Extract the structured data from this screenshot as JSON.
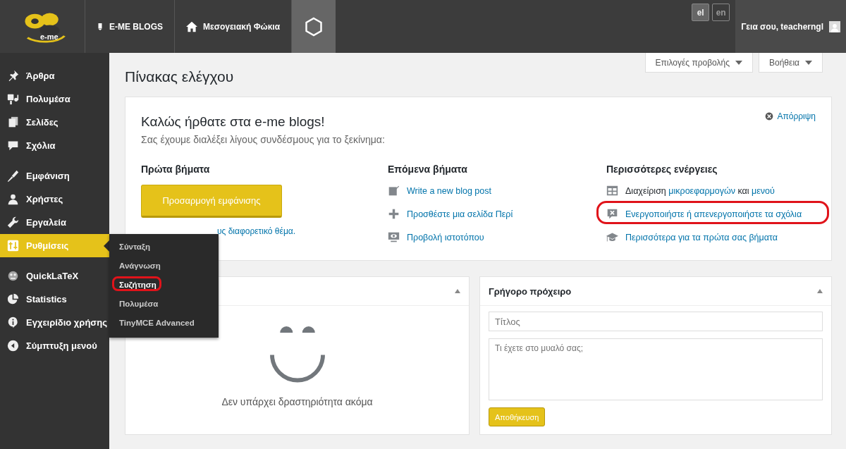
{
  "topbar": {
    "logo_text": "e-me",
    "items": [
      {
        "kind": "blogs",
        "label": "E-ME BLOGS"
      },
      {
        "kind": "site",
        "label": "Μεσογειακή Φώκια"
      },
      {
        "kind": "hexagon"
      }
    ],
    "languages": [
      {
        "label": "el",
        "selected": true
      },
      {
        "label": "en",
        "selected": false
      }
    ],
    "greeting": "Γεια σου, teacherngl"
  },
  "sidebar": {
    "groups": [
      [
        {
          "kind": "pin",
          "label": "Άρθρα",
          "selected": false
        },
        {
          "kind": "media",
          "label": "Πολυμέσα",
          "selected": false
        },
        {
          "kind": "pages",
          "label": "Σελίδες",
          "selected": false
        },
        {
          "kind": "comment",
          "label": "Σχόλια",
          "selected": false
        }
      ],
      [
        {
          "kind": "brush",
          "label": "Εμφάνιση",
          "selected": false
        },
        {
          "kind": "user",
          "label": "Χρήστες",
          "selected": false
        },
        {
          "kind": "wrench",
          "label": "Εργαλεία",
          "selected": false
        },
        {
          "kind": "sliders",
          "label": "Ρυθμίσεις",
          "selected": true
        }
      ],
      [
        {
          "kind": "emblem",
          "label": "QuickLaTeX",
          "selected": false
        },
        {
          "kind": "pie",
          "label": "Statistics",
          "selected": false
        },
        {
          "kind": "info",
          "label": "Εγχειρίδιο χρήσης",
          "selected": false
        },
        {
          "kind": "collapse",
          "label": "Σύμπτυξη μενού",
          "selected": false
        }
      ]
    ],
    "flyout": [
      {
        "label": "Σύνταξη",
        "highlighted": false
      },
      {
        "label": "Ανάγνωση",
        "highlighted": false
      },
      {
        "label": "Συζήτηση",
        "highlighted": true
      },
      {
        "label": "Πολυμέσα",
        "highlighted": false
      },
      {
        "label": "TinyMCE Advanced",
        "highlighted": false
      }
    ]
  },
  "screen_tabs": [
    "Επιλογές προβολής",
    "Βοήθεια"
  ],
  "page_title": "Πίνακας ελέγχου",
  "welcome": {
    "title": "Καλώς ήρθατε στα e-me blogs!",
    "subtitle": "Σας έχουμε διαλέξει λίγους συνδέσμους για το ξεκίνημα:",
    "dismiss": "Απόρριψη",
    "first": {
      "heading": "Πρώτα βήματα",
      "button": "Προσαρμογή εμφάνισης",
      "link": "υς διαφορετικό θέμα."
    },
    "columns": [
      {
        "heading": "Επόμενα βήματα",
        "links": [
          {
            "kind": "edit",
            "highlighted": false,
            "parts": [
              {
                "text": "Write a new blog post",
                "link": true
              }
            ]
          },
          {
            "kind": "plus",
            "highlighted": false,
            "parts": [
              {
                "text": "Προσθέστε μια σελίδα Περί",
                "link": true
              }
            ]
          },
          {
            "kind": "view",
            "highlighted": false,
            "parts": [
              {
                "text": "Προβολή ιστοτόπου",
                "link": true
              }
            ]
          }
        ]
      },
      {
        "heading": "Περισσότερες ενέργειες",
        "links": [
          {
            "kind": "widgets",
            "highlighted": false,
            "parts": [
              {
                "text": "Διαχείριση ",
                "link": false
              },
              {
                "text": "μικροεφαρμογών",
                "link": true
              },
              {
                "text": " και ",
                "link": false
              },
              {
                "text": "μενού",
                "link": true
              }
            ]
          },
          {
            "kind": "nocomment",
            "highlighted": true,
            "parts": [
              {
                "text": "Ενεργοποιήστε ή απενεργοποιήστε τα σχόλια",
                "link": true
              }
            ]
          },
          {
            "kind": "learn",
            "highlighted": false,
            "parts": [
              {
                "text": "Περισσότερα για τα πρώτα σας βήματα",
                "link": true
              }
            ]
          }
        ]
      }
    ]
  },
  "activity": {
    "empty_text": "Δεν υπάρχει δραστηριότητα ακόμα"
  },
  "quick_draft": {
    "title": "Γρήγορο πρόχειρο",
    "title_placeholder": "Τίτλος",
    "content_placeholder": "Τι έχετε στο μυαλό σας;",
    "button": "Αποθήκευση"
  }
}
